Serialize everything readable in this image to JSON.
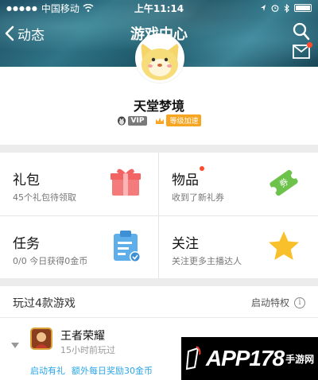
{
  "status_bar": {
    "carrier": "中国移动",
    "time": "上午11:14"
  },
  "nav": {
    "back_label": "动态",
    "title": "游戏中心"
  },
  "profile": {
    "username": "天堂梦境",
    "vip_label": "VIP",
    "accel_label": "等级加速"
  },
  "grid": [
    {
      "title": "礼包",
      "subtitle": "45个礼包待领取",
      "icon": "gift-icon",
      "has_dot": false
    },
    {
      "title": "物品",
      "subtitle": "收到了新礼券",
      "icon": "coupon-icon",
      "has_dot": true
    },
    {
      "title": "任务",
      "subtitle": "0/0 今日获得0金币",
      "icon": "clipboard-icon",
      "has_dot": false
    },
    {
      "title": "关注",
      "subtitle": "关注更多主播达人",
      "icon": "star-icon",
      "has_dot": false
    }
  ],
  "played": {
    "title": "玩过4款游戏",
    "launch_label": "启动特权",
    "info_symbol": "i"
  },
  "game": {
    "name": "王者荣耀",
    "last_played": "15小时前玩过",
    "promo_1": "启动有礼",
    "promo_2": "额外每日奖励30金币"
  },
  "watermark": {
    "text": "APP178",
    "sub": "手游网"
  },
  "colors": {
    "accent_blue": "#2aa6e8",
    "badge_orange": "#f6a623",
    "notify_red": "#ff4a2e"
  }
}
